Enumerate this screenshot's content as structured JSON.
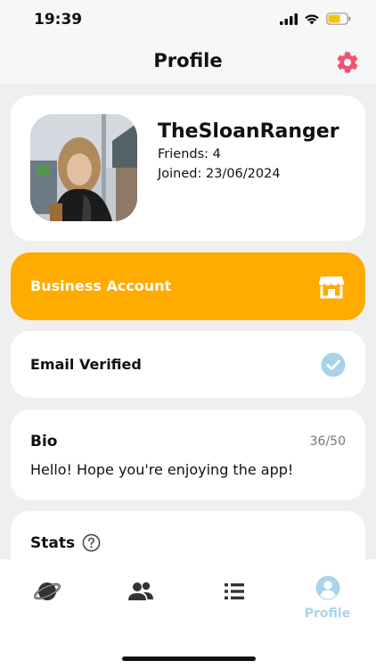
{
  "status_bar": {
    "time": "19:39",
    "battery_color": "#f5c400"
  },
  "header": {
    "title": "Profile",
    "settings_icon": "gear-icon",
    "settings_color": "#ee5573"
  },
  "profile": {
    "username": "TheSloanRanger",
    "friends": "Friends: 4",
    "joined": "Joined: 23/06/2024"
  },
  "business": {
    "label": "Business Account",
    "icon": "store-icon",
    "color": "#ffab00"
  },
  "email": {
    "label": "Email Verified",
    "icon": "check-circle-icon",
    "check_color": "#8ec9e4"
  },
  "bio": {
    "title": "Bio",
    "count": "36/50",
    "text": "Hello! Hope you're enjoying the app!"
  },
  "stats": {
    "title": "Stats",
    "icon": "help-circle-icon"
  },
  "tabs": [
    {
      "name": "explore",
      "icon": "planet-icon",
      "label": ""
    },
    {
      "name": "friends",
      "icon": "users-icon",
      "label": ""
    },
    {
      "name": "list",
      "icon": "list-icon",
      "label": ""
    },
    {
      "name": "profile",
      "icon": "user-circle-icon",
      "label": "Profile",
      "active": true
    }
  ],
  "colors": {
    "active_tab": "#a9d4ea",
    "icon_dark": "#333333"
  }
}
